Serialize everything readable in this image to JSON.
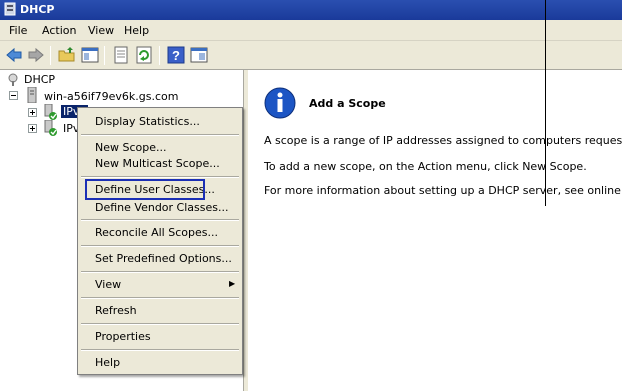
{
  "window": {
    "title": "DHCP"
  },
  "menubar": {
    "items": [
      "File",
      "Action",
      "View",
      "Help"
    ]
  },
  "toolbar": {
    "buttons": [
      "back-icon",
      "forward-icon",
      "up-folder-icon",
      "show-hide-tree-icon",
      "export-list-icon",
      "refresh-icon",
      "help-icon",
      "properties-icon"
    ]
  },
  "tree": {
    "root": "DHCP",
    "server": "win-a56if79ev6k.gs.com",
    "ipv4_partial": "IPv4",
    "ipv6_partial": "IPv"
  },
  "context_menu": {
    "items": [
      "Display Statistics...",
      "New Scope...",
      "New Multicast Scope...",
      "Define User Classes...",
      "Define Vendor Classes...",
      "Reconcile All Scopes...",
      "Set Predefined Options...",
      "View",
      "Refresh",
      "Properties",
      "Help"
    ],
    "submenu_arrow": "▶"
  },
  "right_pane": {
    "title": "Add a Scope",
    "line1": "A scope is a range of IP addresses assigned to computers requesting a dyn",
    "line2": "To add a new scope, on the Action menu, click New Scope.",
    "line3": "For more information about setting up a DHCP server, see online Help."
  },
  "colors": {
    "titlebar": "#1a3a9a",
    "focus_outline": "#1b2fb5",
    "info_icon": "#1c55c4"
  }
}
